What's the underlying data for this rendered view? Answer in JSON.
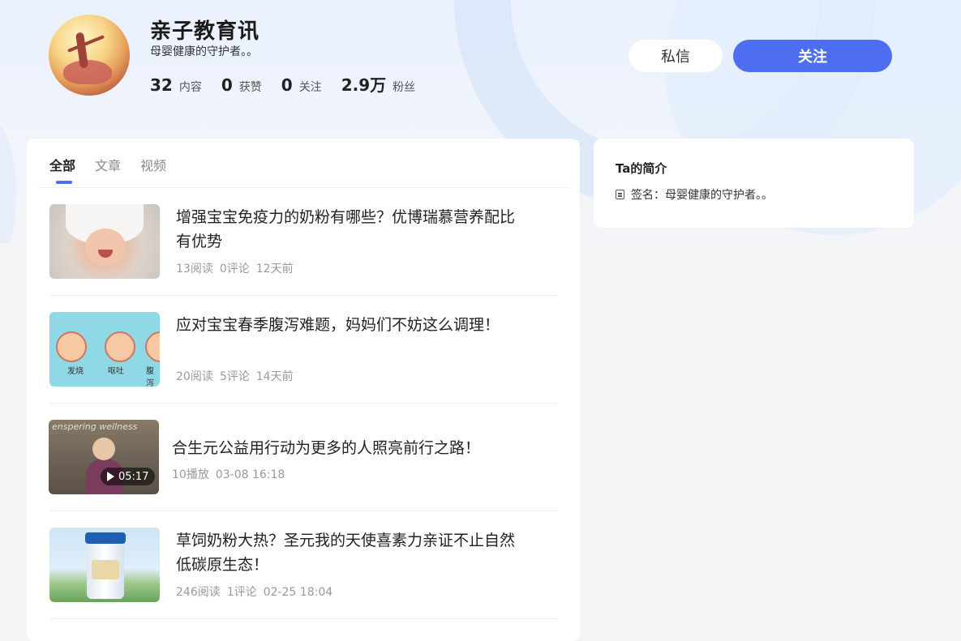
{
  "profile": {
    "name": "亲子教育讯",
    "bio": "母婴健康的守护者。。",
    "stats": [
      {
        "num": "32",
        "label": "内容"
      },
      {
        "num": "0",
        "label": "获赞"
      },
      {
        "num": "0",
        "label": "关注"
      },
      {
        "num": "2.9万",
        "label": "粉丝"
      }
    ]
  },
  "actions": {
    "message_label": "私信",
    "follow_label": "关注"
  },
  "tabs": [
    {
      "label": "全部",
      "active": true
    },
    {
      "label": "文章",
      "active": false
    },
    {
      "label": "视频",
      "active": false
    }
  ],
  "feed": [
    {
      "title": "增强宝宝免疫力的奶粉有哪些？优博瑞慕营养配比有优势",
      "reads": "13阅读",
      "comments": "0评论",
      "time": "12天前"
    },
    {
      "title": "应对宝宝春季腹泻难题，妈妈们不妨这么调理！",
      "reads": "20阅读",
      "comments": "5评论",
      "time": "14天前",
      "thumb_labels": [
        "发烧",
        "呕吐",
        "腹泻"
      ]
    },
    {
      "title": "合生元公益用行动为更多的人照亮前行之路！",
      "reads": "10播放",
      "time": "03-08 16:18",
      "duration": "05:17",
      "thumb_text": "enspering wellness"
    },
    {
      "title": "草饲奶粉大热？圣元我的天使喜素力亲证不止自然低碳原生态！",
      "reads": "246阅读",
      "comments": "1评论",
      "time": "02-25 18:04"
    }
  ],
  "intro": {
    "title": "Ta的简介",
    "signature": "签名：母婴健康的守护者。。"
  },
  "colors": {
    "accent": "#4e6ef2"
  }
}
